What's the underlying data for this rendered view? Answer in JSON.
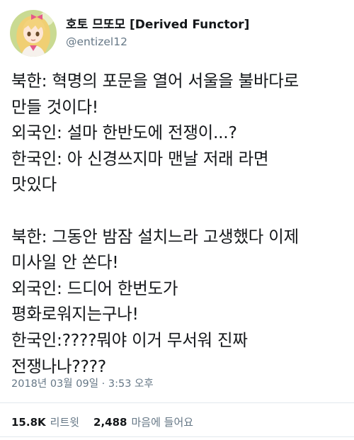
{
  "tweet": {
    "display_name": "호토 므또모 [Derived Functor]",
    "handle": "@entizel12",
    "body_lines": [
      "북한: 혁명의 포문을 열어 서울을 불바다로",
      "만들 것이다!",
      "외국인: 설마 한반도에 전쟁이...?",
      "한국인: 아 신경쓰지마 맨날 저래 라면",
      "맛있다",
      "",
      "북한: 그동안 밤잠 설치느라 고생했다 이제",
      "미사일 안 쏜다!",
      "외국인: 드디어 한번도가",
      "평화로워지는구나!",
      "한국인:????뭐야 이거 무서워 진짜",
      "전쟁나나????"
    ],
    "timestamp": "2018년 03월 09일 · 3:53 오후",
    "retweets_count": "15.8K",
    "retweets_label": "리트윗",
    "likes_count": "2,488",
    "likes_label": "마음에 들어요"
  },
  "colors": {
    "text_primary": "#14171a",
    "text_secondary": "#657786",
    "divider": "#e1e8ed",
    "avatar_bg": "#c7d98f",
    "avatar_hair": "#f2d37a"
  },
  "icons": {
    "avatar": "anime-girl-avatar"
  }
}
